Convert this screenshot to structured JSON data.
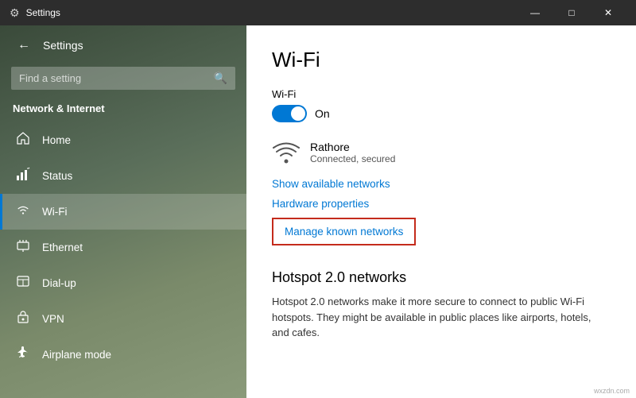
{
  "titleBar": {
    "icon": "⚙",
    "title": "Settings",
    "minimize": "—",
    "maximize": "□",
    "close": "✕"
  },
  "sidebar": {
    "backBtn": "←",
    "appTitle": "Settings",
    "search": {
      "placeholder": "Find a setting",
      "icon": "🔍"
    },
    "sectionTitle": "Network & Internet",
    "navItems": [
      {
        "icon": "🏠",
        "label": "Home",
        "active": false
      },
      {
        "icon": "📶",
        "label": "Status",
        "active": false
      },
      {
        "icon": "📡",
        "label": "Wi-Fi",
        "active": true
      },
      {
        "icon": "🖥",
        "label": "Ethernet",
        "active": false
      },
      {
        "icon": "📞",
        "label": "Dial-up",
        "active": false
      },
      {
        "icon": "🔒",
        "label": "VPN",
        "active": false
      },
      {
        "icon": "✈",
        "label": "Airplane mode",
        "active": false
      }
    ]
  },
  "main": {
    "pageTitle": "Wi-Fi",
    "wifiLabel": "Wi-Fi",
    "toggleState": "On",
    "network": {
      "name": "Rathore",
      "status": "Connected, secured"
    },
    "showNetworksLink": "Show available networks",
    "hardwareLink": "Hardware properties",
    "manageLink": "Manage known networks",
    "hotspot": {
      "title": "Hotspot 2.0 networks",
      "description": "Hotspot 2.0 networks make it more secure to connect to public Wi-Fi hotspots. They might be available in public places like airports, hotels, and cafes."
    }
  },
  "watermark": "wxzdn.com"
}
